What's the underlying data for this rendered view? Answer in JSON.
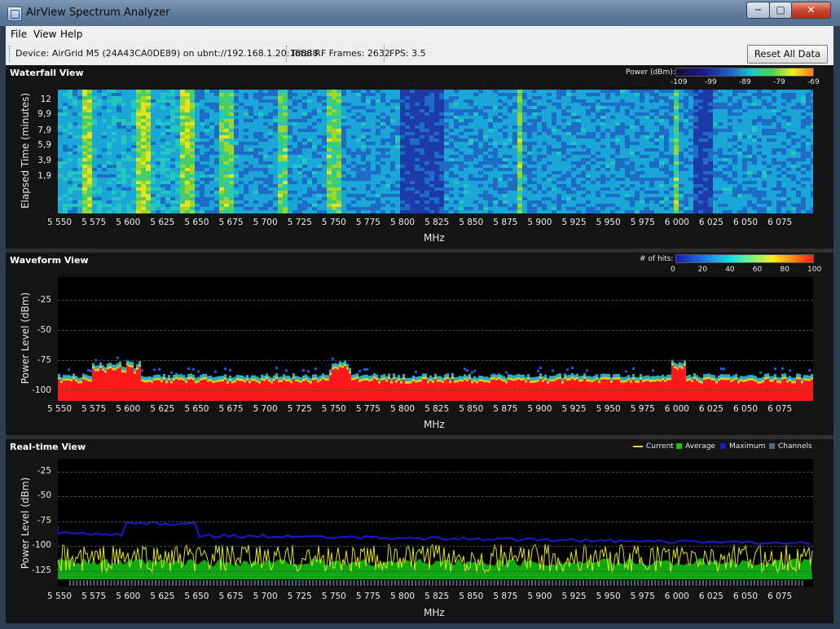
{
  "window": {
    "title": "AirView Spectrum Analyzer",
    "min_label": "─",
    "max_label": "▢",
    "close_label": "✕"
  },
  "menu": [
    "File",
    "View",
    "Help"
  ],
  "status": {
    "device": "Device: AirGrid M5 (24A43CA0DE89) on ubnt://192.168.1.20:18888",
    "frames": "Total RF Frames: 2632",
    "fps": "FPS: 3.5",
    "reset_label": "Reset All Data"
  },
  "xaxis": {
    "title": "MHz",
    "ticks": [
      "5 550",
      "5 575",
      "5 600",
      "5 625",
      "5 650",
      "5 675",
      "5 700",
      "5 725",
      "5 750",
      "5 775",
      "5 800",
      "5 825",
      "5 850",
      "5 875",
      "5 900",
      "5 925",
      "5 950",
      "5 975",
      "6 000",
      "6 025",
      "6 050",
      "6 075"
    ]
  },
  "waterfall": {
    "title": "Waterfall View",
    "ylabel": "Elapsed Time (minutes)",
    "yticks": [
      "12",
      "9,9",
      "7,9",
      "5,9",
      "3,9",
      "1,9"
    ],
    "legend_title": "Power (dBm):",
    "legend_ticks": [
      "-109",
      "-99",
      "-89",
      "-79",
      "-69"
    ]
  },
  "waveform": {
    "title": "Waveform View",
    "ylabel": "Power Level (dBm)",
    "yticks": [
      "-25",
      "-50",
      "-75",
      "-100"
    ],
    "legend_title": "# of hits:",
    "legend_ticks": [
      "0",
      "20",
      "40",
      "60",
      "80",
      "100"
    ]
  },
  "realtime": {
    "title": "Real-time View",
    "ylabel": "Power Level (dBm)",
    "yticks": [
      "-25",
      "-50",
      "-75",
      "-100",
      "-125"
    ],
    "legend": [
      {
        "label": "Current",
        "color": "#d9e021"
      },
      {
        "label": "Average",
        "color": "#19c219"
      },
      {
        "label": "Maximum",
        "color": "#1a1ac8"
      },
      {
        "label": "Channels",
        "color": "#4f6b7a"
      }
    ]
  },
  "colors": {
    "accent_red": "#ff1a1a",
    "max_line": "#1a1ad0",
    "avg_fill": "#0fa812",
    "current_line": "#e1e61e"
  }
}
